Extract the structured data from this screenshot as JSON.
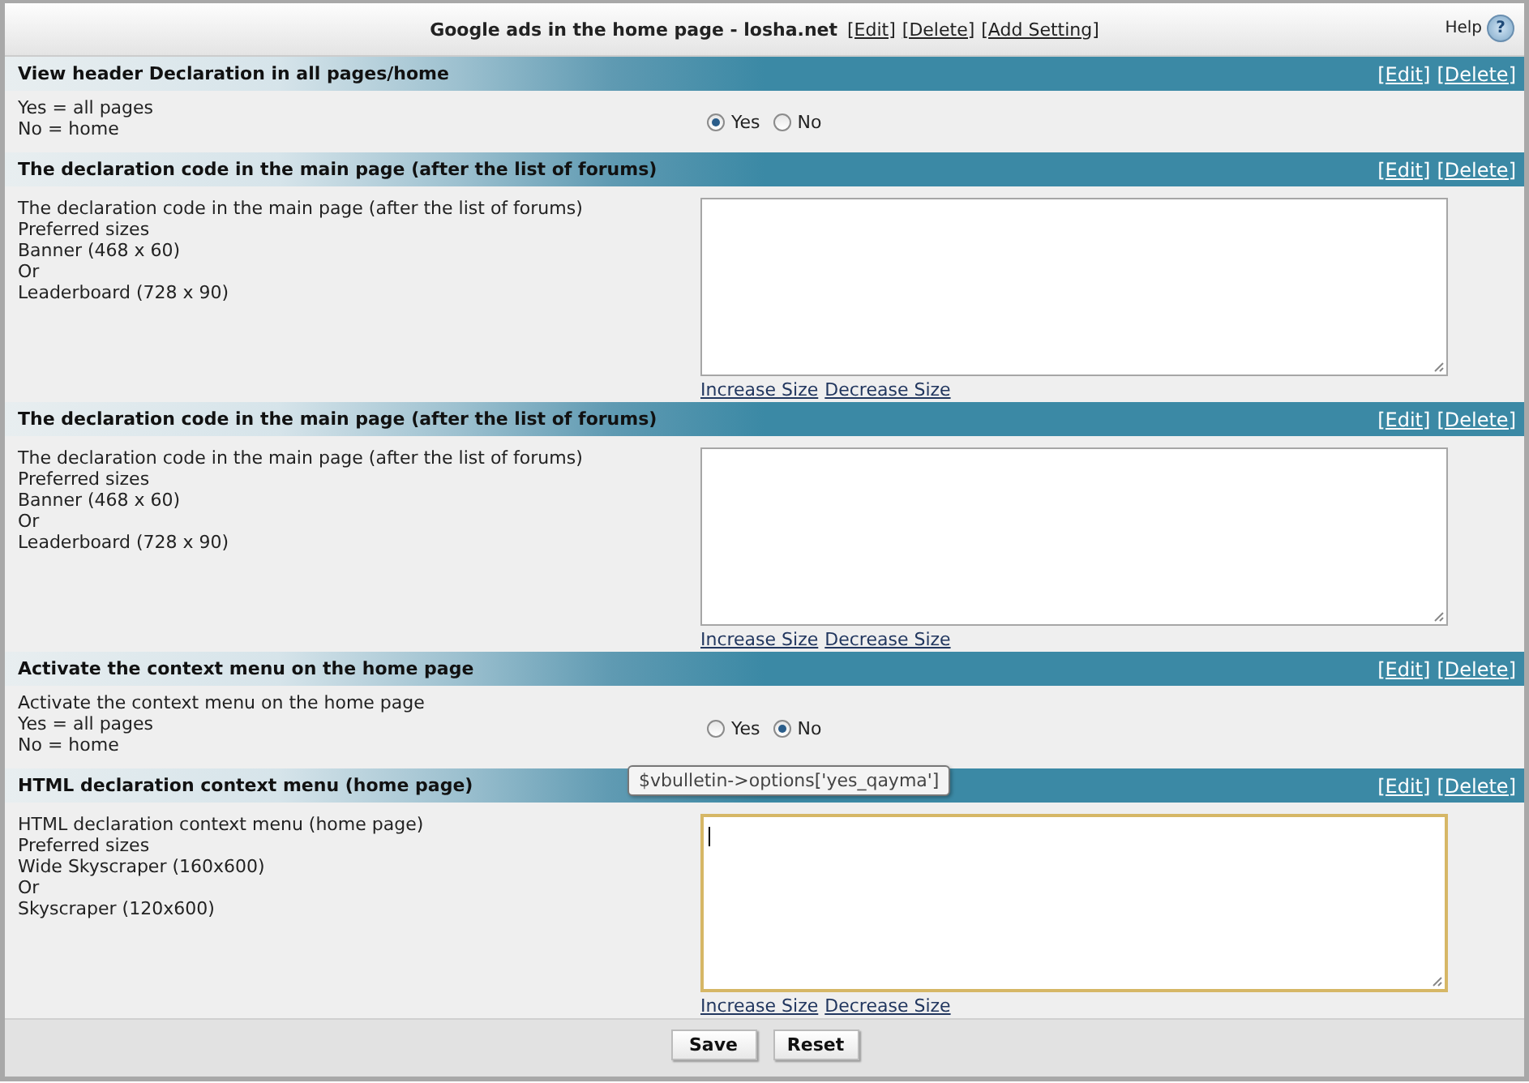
{
  "header": {
    "title": "Google ads in the home page - losha.net",
    "links": [
      "[Edit]",
      "[Delete]",
      "[Add Setting]"
    ],
    "help": "Help",
    "help_icon": "?"
  },
  "sections": [
    {
      "kind": "radio",
      "heading": "View header Declaration in all pages/home",
      "actions": [
        "[Edit]",
        "[Delete]"
      ],
      "description": [
        "Yes = all pages",
        "No = home"
      ],
      "options": [
        {
          "label": "Yes",
          "selected": true
        },
        {
          "label": "No",
          "selected": false
        }
      ]
    },
    {
      "kind": "textarea",
      "heading": "The declaration code in the main page (after the list of forums)",
      "actions": [
        "[Edit]",
        "[Delete]"
      ],
      "description": [
        "The declaration code in the main page (after the list of forums)",
        "Preferred sizes",
        "Banner (468 x 60)",
        "Or",
        "Leaderboard (728 x 90)"
      ],
      "focused": false,
      "links": [
        "Increase Size",
        "Decrease Size"
      ]
    },
    {
      "kind": "textarea",
      "heading": "The declaration code in the main page (after the list of forums)",
      "actions": [
        "[Edit]",
        "[Delete]"
      ],
      "description": [
        "The declaration code in the main page (after the list of forums)",
        "Preferred sizes",
        "Banner (468 x 60)",
        "Or",
        "Leaderboard (728 x 90)"
      ],
      "focused": false,
      "links": [
        "Increase Size",
        "Decrease Size"
      ]
    },
    {
      "kind": "radio",
      "heading": "Activate the context menu on the home page",
      "actions": [
        "[Edit]",
        "[Delete]"
      ],
      "description": [
        "Activate the context menu on the home page",
        "Yes = all pages",
        "No = home"
      ],
      "options": [
        {
          "label": "Yes",
          "selected": false
        },
        {
          "label": "No",
          "selected": true
        }
      ]
    },
    {
      "kind": "textarea",
      "heading": "HTML declaration context menu (home page)",
      "actions": [
        "[Edit]",
        "[Delete]"
      ],
      "description": [
        "HTML declaration context menu (home page)",
        "Preferred sizes",
        "Wide Skyscraper (160x600)",
        "Or",
        "Skyscraper (120x600)"
      ],
      "focused": true,
      "links": [
        "Increase Size",
        "Decrease Size"
      ],
      "tooltip": "$vbulletin->options['yes_qayma']"
    }
  ],
  "buttons": [
    "Save",
    "Reset"
  ]
}
